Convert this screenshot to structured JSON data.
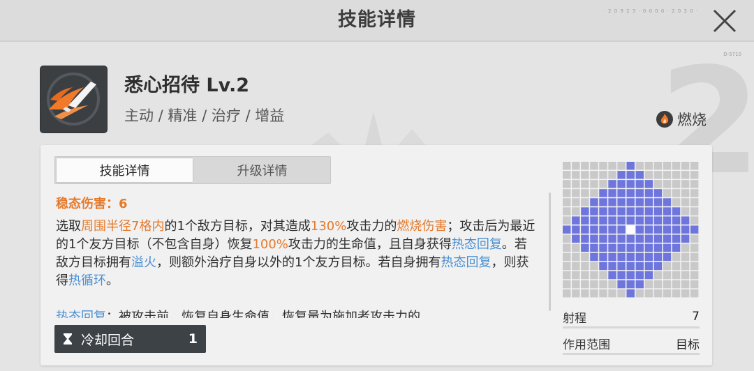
{
  "header": {
    "title": "技能详情",
    "code_top": "· 2 0 9 2 3 · 0 0 0 0 · 2 0 3 0 ·",
    "code_side": "D-5710"
  },
  "skill": {
    "name": "悉心招待 Lv.2",
    "tags": "主动 / 精准 / 治疗 / 增益",
    "element": {
      "label": "燃烧",
      "icon": "fire-icon"
    },
    "background_number": "2"
  },
  "tabs": [
    {
      "label": "技能详情",
      "active": true
    },
    {
      "label": "升级详情",
      "active": false
    }
  ],
  "damage": {
    "label": "稳态伤害：",
    "value": "6"
  },
  "description": {
    "p1": "选取",
    "p2": "周围半径7格内",
    "p3": "的1个敌方目标，对其造成",
    "p4": "130%",
    "p5": "攻击力的",
    "p6": "燃烧伤害",
    "p7": "；攻击后为最近的1个友方目标（不包含自身）恢复",
    "p8": "100%",
    "p9": "攻击力的生命值，且自身获得",
    "p10": "热态回复",
    "p11": "。若敌方目标拥有",
    "p12": "溢火",
    "p13": "，则额外治疗自身以外的1个友方目标。若自身拥有",
    "p14": "热态回复",
    "p15": "，则获得",
    "p16": "热循环",
    "p17": "。"
  },
  "description_more": {
    "k": "热态回复",
    "t": "：被攻击前，恢复自身生命值，恢复量为施加者攻击力的"
  },
  "cooldown": {
    "label": "冷却回合",
    "value": "1",
    "icon": "hourglass-icon"
  },
  "range": {
    "size": 15,
    "radius": 7,
    "colors": {
      "empty": "#c9c9c9",
      "range": "#6e76de",
      "center": "#ffffff",
      "direction": "#e98a3c"
    },
    "stats": [
      {
        "label": "射程",
        "value": "7"
      },
      {
        "label": "作用范围",
        "value": "目标"
      }
    ]
  }
}
